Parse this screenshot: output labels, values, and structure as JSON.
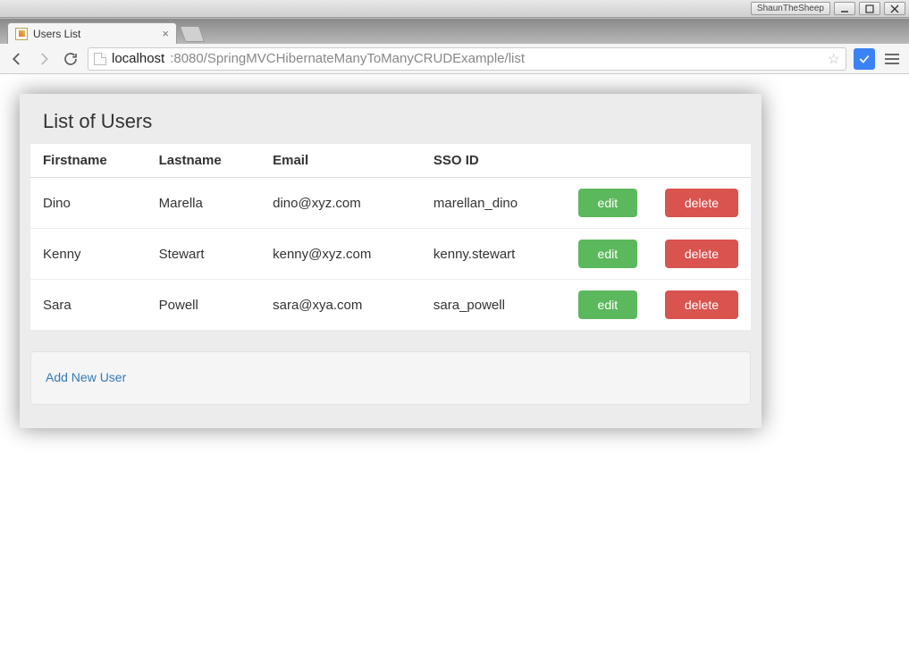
{
  "os": {
    "user_badge": "ShaunTheSheep"
  },
  "browser": {
    "tab_title": "Users List",
    "url_scheme_host": "localhost",
    "url_port_path": ":8080/SpringMVCHibernateManyToManyCRUDExample/list"
  },
  "page": {
    "heading": "List of Users",
    "columns": {
      "firstname": "Firstname",
      "lastname": "Lastname",
      "email": "Email",
      "sso": "SSO ID"
    },
    "rows": [
      {
        "firstname": "Dino",
        "lastname": "Marella",
        "email": "dino@xyz.com",
        "sso": "marellan_dino"
      },
      {
        "firstname": "Kenny",
        "lastname": "Stewart",
        "email": "kenny@xyz.com",
        "sso": "kenny.stewart"
      },
      {
        "firstname": "Sara",
        "lastname": "Powell",
        "email": "sara@xya.com",
        "sso": "sara_powell"
      }
    ],
    "buttons": {
      "edit": "edit",
      "delete": "delete"
    },
    "add_link": "Add New User"
  }
}
